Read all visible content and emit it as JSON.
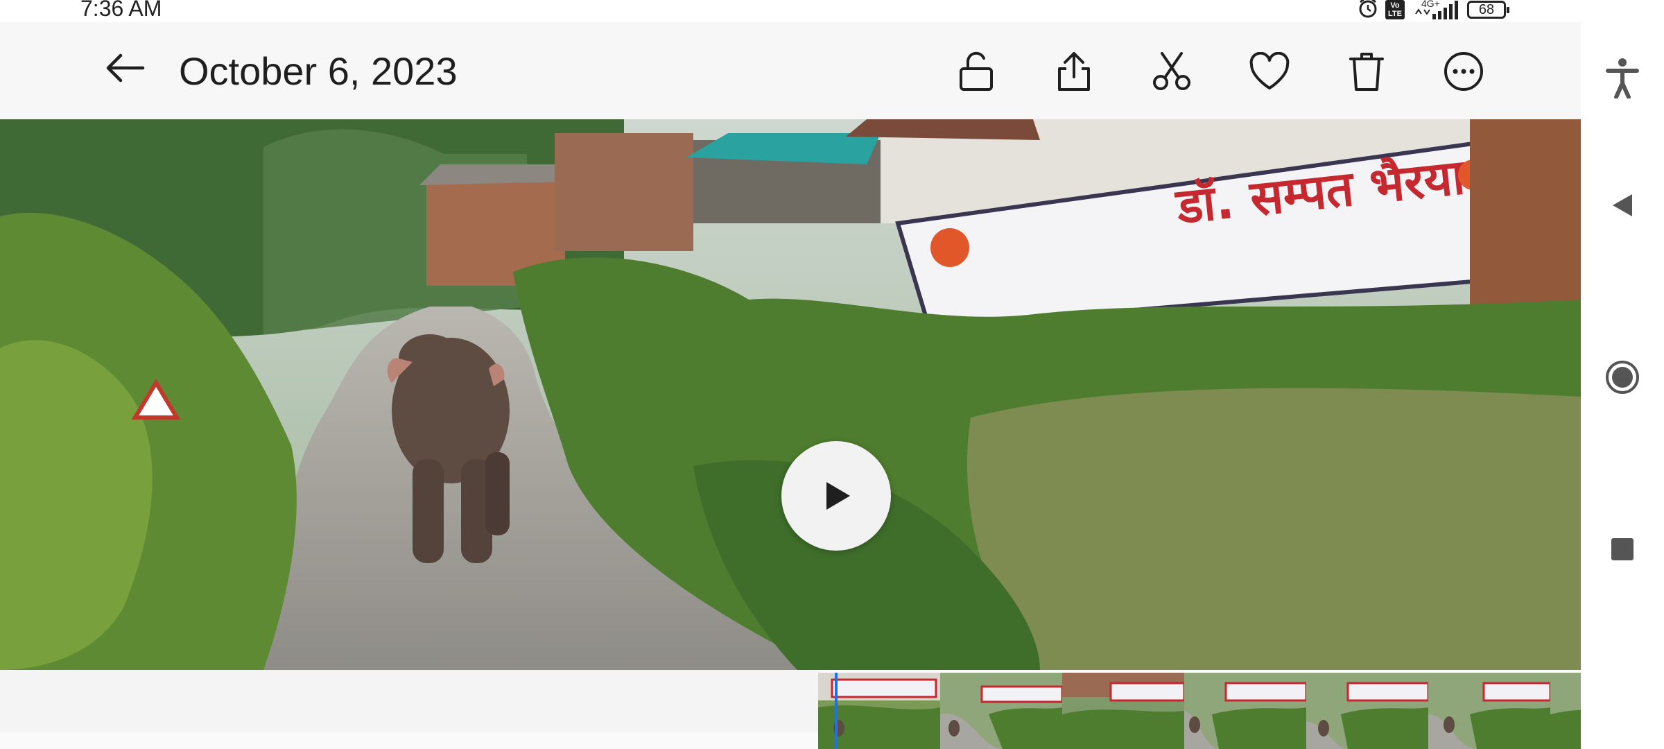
{
  "status_bar": {
    "time": "7:36 AM",
    "network_label": "4G+",
    "volte_label": "Vo\nLTE",
    "battery": "68",
    "icons": [
      "alarm-icon",
      "volte-icon",
      "signal-icon",
      "battery-icon"
    ]
  },
  "app_bar": {
    "title": "October 6, 2023",
    "actions": [
      {
        "name": "unlock-icon",
        "label": "Lock"
      },
      {
        "name": "share-icon",
        "label": "Share"
      },
      {
        "name": "cut-icon",
        "label": "Trim"
      },
      {
        "name": "heart-icon",
        "label": "Favorite"
      },
      {
        "name": "delete-icon",
        "label": "Delete"
      },
      {
        "name": "more-icon",
        "label": "More options"
      }
    ]
  },
  "video": {
    "wall_sign_text": "डॉ. सम्पत भैरया"
  },
  "timeline": {
    "thumbnail_count": 7
  },
  "nav_bar": {
    "buttons": [
      "accessibility-icon",
      "back-triangle-icon",
      "home-circle-icon",
      "recents-square-icon"
    ]
  },
  "colors": {
    "accent": "#1a73e8",
    "app_bar_bg": "#f7f7f7",
    "foliage": "#4f7d2f",
    "road": "#9e9c96"
  }
}
